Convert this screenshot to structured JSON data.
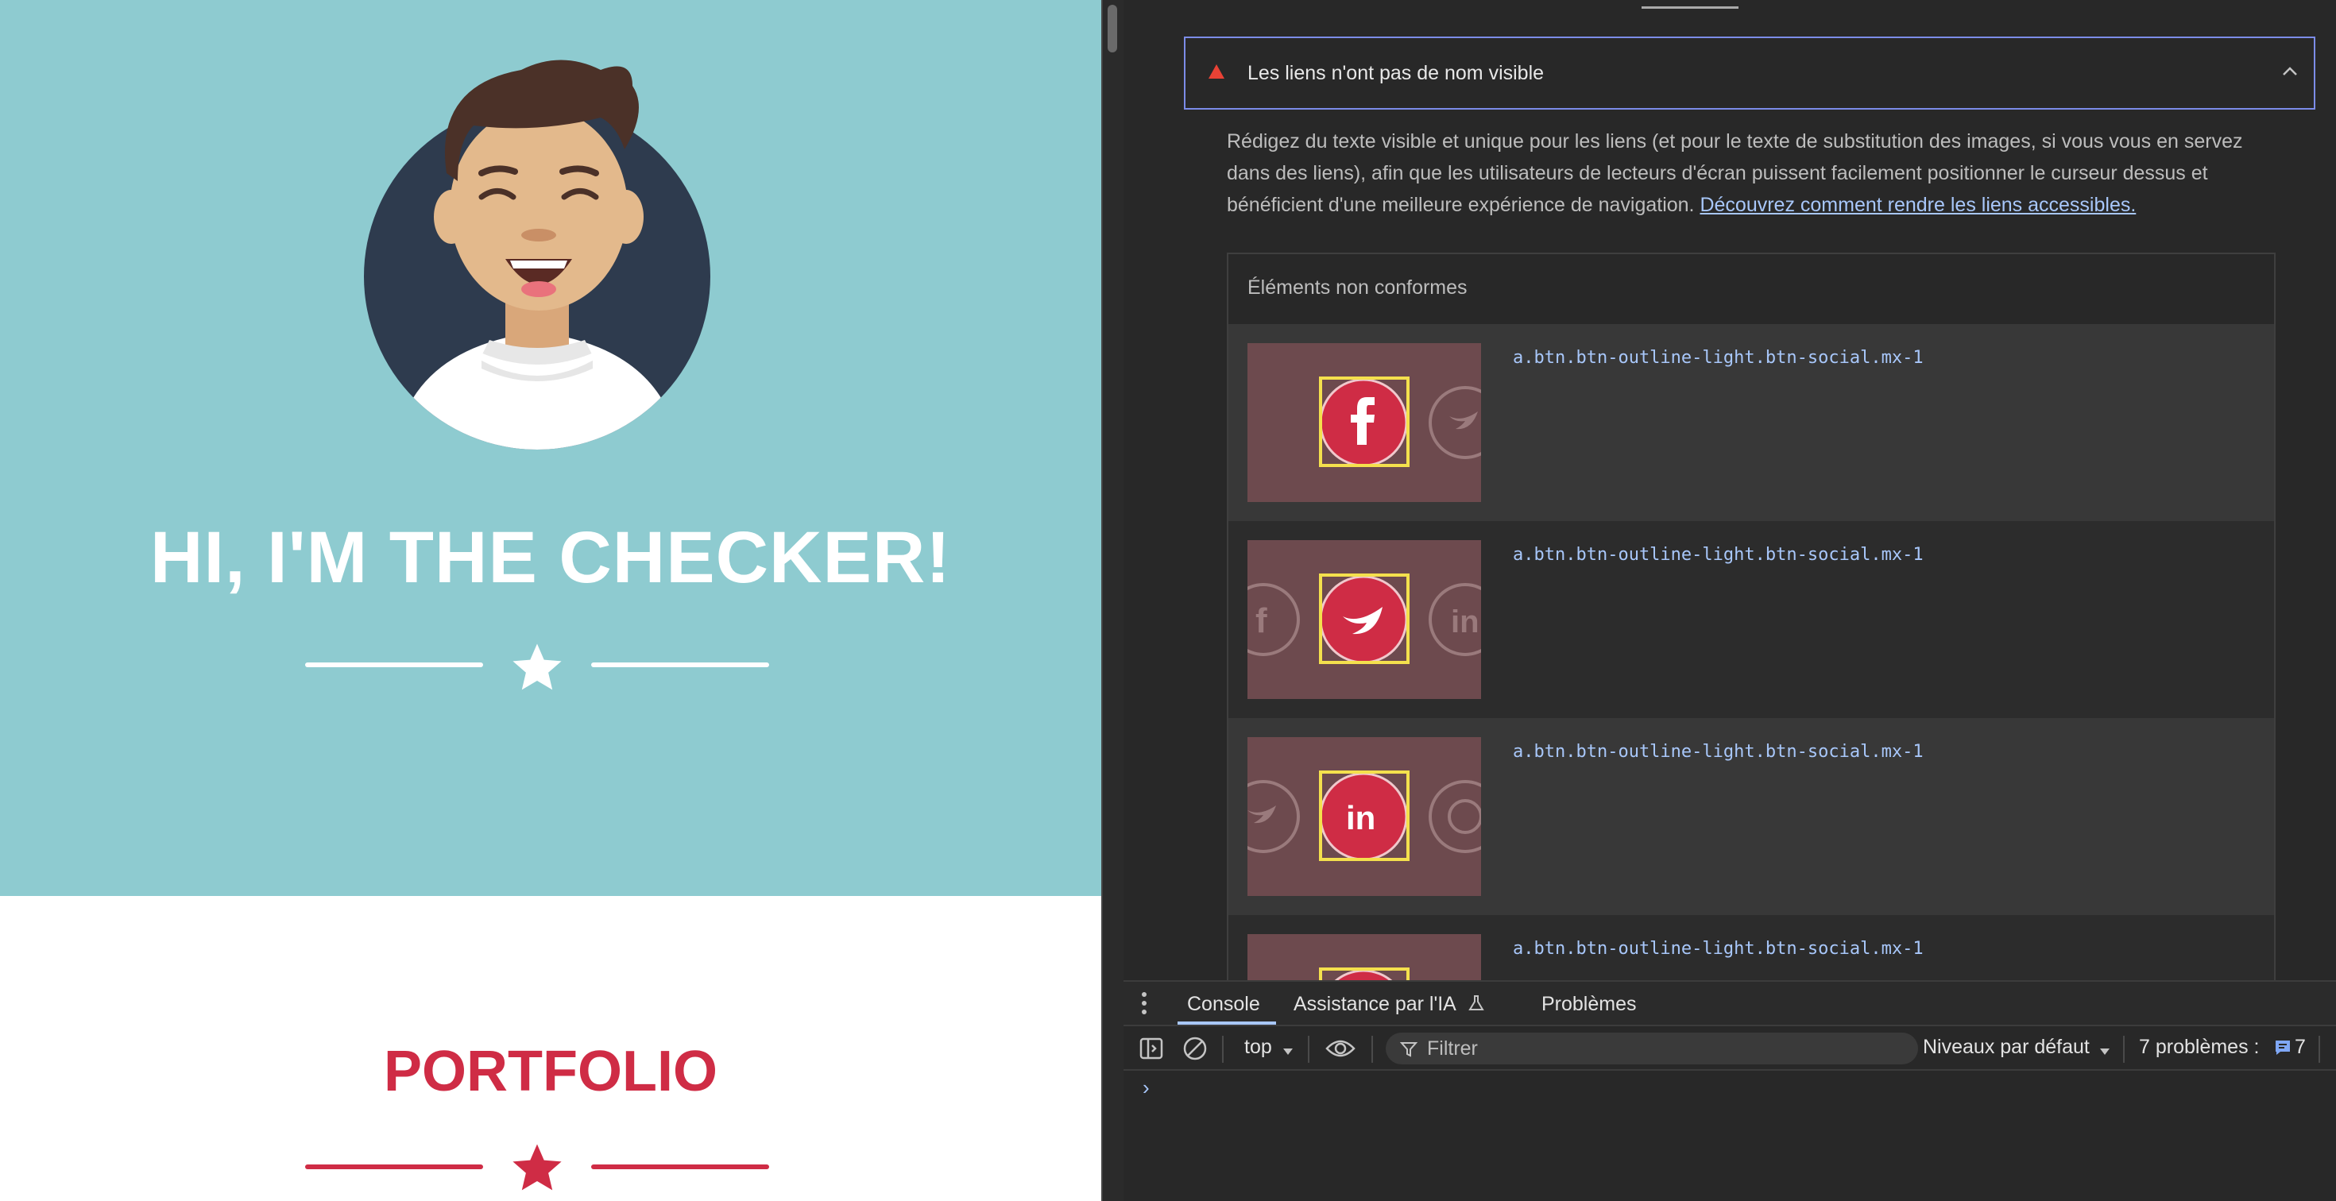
{
  "page": {
    "hero_title": "HI, I'M THE CHECKER!",
    "section_title": "PORTFOLIO"
  },
  "audit": {
    "title": "Les liens n'ont pas de nom visible",
    "description": "Rédigez du texte visible et unique pour les liens (et pour le texte de substitution des images, si vous vous en servez dans des liens), afin que les utilisateurs de lecteurs d'écran puissent facilement positionner le curseur dessus et bénéficient d'une meilleure expérience de navigation. ",
    "learn_more": "Découvrez comment rendre les liens accessibles.",
    "table_header": "Éléments non conformes",
    "items": [
      {
        "selector": "a.btn.btn-outline-light.btn-social.mx-1",
        "icon": "facebook-icon"
      },
      {
        "selector": "a.btn.btn-outline-light.btn-social.mx-1",
        "icon": "twitter-icon"
      },
      {
        "selector": "a.btn.btn-outline-light.btn-social.mx-1",
        "icon": "linkedin-icon"
      },
      {
        "selector": "a.btn.btn-outline-light.btn-social.mx-1",
        "icon": "dribbble-icon"
      }
    ]
  },
  "drawer": {
    "tabs": [
      "Console",
      "Assistance par l'IA",
      "Problèmes"
    ],
    "context": "top",
    "filter_placeholder": "Filtrer",
    "levels": "Niveaux par défaut",
    "issues_label": "7 problèmes :",
    "issues_count": "7",
    "prompt": "›"
  },
  "colors": {
    "hero_bg": "#8ecbd0",
    "brand_red": "#cf2c45",
    "devtools_bg": "#282828",
    "link": "#a8c7fa",
    "focus_border": "#7c8ce8"
  }
}
